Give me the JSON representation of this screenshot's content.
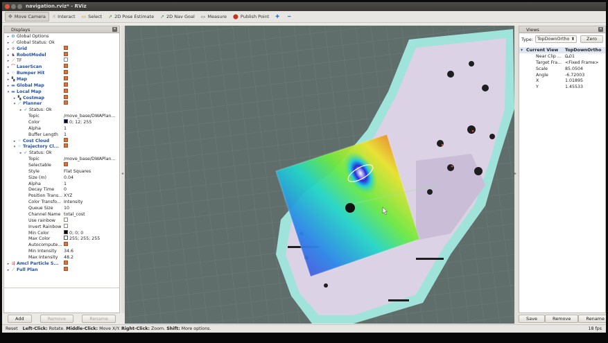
{
  "window": {
    "title": "navigation.rviz* - RViz"
  },
  "toolbar": [
    {
      "label": "Move Camera",
      "icon": "move-camera-icon",
      "glyph": "✥",
      "color": "#666",
      "active": true
    },
    {
      "label": "Interact",
      "icon": "interact-hand-icon",
      "glyph": "☝",
      "color": "#444"
    },
    {
      "label": "Select",
      "icon": "select-box-icon",
      "glyph": "▭",
      "color": "#b89a00"
    },
    {
      "label": "2D Pose Estimate",
      "icon": "pose-estimate-arrow-icon",
      "glyph": "➚",
      "color": "#2f9b2f"
    },
    {
      "label": "2D Nav Goal",
      "icon": "nav-goal-arrow-icon",
      "glyph": "➚",
      "color": "#2f9b2f"
    },
    {
      "label": "Measure",
      "icon": "measure-icon",
      "glyph": "▭",
      "color": "#555"
    },
    {
      "label": "Publish Point",
      "icon": "publish-point-pin-icon",
      "glyph": "⬤",
      "color": "#c4341f"
    },
    {
      "label": "",
      "icon": "add-tool-plus-icon",
      "glyph": "✚",
      "color": "#2a6fd6"
    },
    {
      "label": "",
      "icon": "remove-tool-minus-icon",
      "glyph": "━",
      "color": "#2a6fd6"
    }
  ],
  "displays": {
    "title": "Displays",
    "rows": [
      {
        "indent": 0,
        "arrow": "▸",
        "icon": "gear-icon",
        "glyph": "⚙",
        "glyph_color": "#2a6fd6",
        "label": "Global Options",
        "style": "plain",
        "value": ""
      },
      {
        "indent": 0,
        "arrow": "▸",
        "icon": "checkmark-icon",
        "glyph": "✓",
        "glyph_color": "#2a8a2a",
        "label": "Global Status: Ok",
        "style": "plain",
        "value": ""
      },
      {
        "indent": 0,
        "arrow": "▸",
        "icon": "grid-icon",
        "glyph": "✣",
        "glyph_color": "#777",
        "label": "Grid",
        "style": "blue",
        "checkbox": true
      },
      {
        "indent": 0,
        "arrow": "▸",
        "icon": "robot-model-icon",
        "glyph": "♞",
        "glyph_color": "#555",
        "label": "RobotModel",
        "style": "blue",
        "checkbox": true
      },
      {
        "indent": 0,
        "arrow": "▸",
        "icon": "tf-axes-icon",
        "glyph": "⟋",
        "glyph_color": "#d44",
        "label": "TF",
        "style": "plain",
        "checkbox": false
      },
      {
        "indent": 0,
        "arrow": "▸",
        "icon": "laser-scan-icon",
        "glyph": "⌒",
        "glyph_color": "#d22",
        "label": "LaserScan",
        "style": "blue",
        "checkbox": true
      },
      {
        "indent": 0,
        "arrow": "▸",
        "icon": "bumper-points-icon",
        "glyph": "⁘",
        "glyph_color": "#2a6fd6",
        "label": "Bumper Hit",
        "style": "blue",
        "checkbox": true
      },
      {
        "indent": 0,
        "arrow": "▸",
        "icon": "map-icon",
        "glyph": "▚",
        "glyph_color": "#555",
        "label": "Map",
        "style": "blue",
        "checkbox": true
      },
      {
        "indent": 0,
        "arrow": "▸",
        "icon": "folder-icon",
        "glyph": "▬",
        "glyph_color": "#5a7fb5",
        "label": "Global Map",
        "style": "blue",
        "checkbox": true
      },
      {
        "indent": 0,
        "arrow": "▾",
        "icon": "folder-icon",
        "glyph": "▬",
        "glyph_color": "#5a7fb5",
        "label": "Local Map",
        "style": "blue",
        "checkbox": true
      },
      {
        "indent": 1,
        "arrow": "▸",
        "icon": "map-icon",
        "glyph": "▚",
        "glyph_color": "#555",
        "label": "Costmap",
        "style": "blue",
        "checkbox": true
      },
      {
        "indent": 1,
        "arrow": "▾",
        "icon": "path-icon",
        "glyph": "⟋",
        "glyph_color": "#2a9a2a",
        "label": "Planner",
        "style": "blue",
        "checkbox": true
      },
      {
        "indent": 2,
        "arrow": "▸",
        "icon": "checkmark-icon",
        "glyph": "✓",
        "glyph_color": "#2a8a2a",
        "label": "Status: Ok",
        "style": "plain",
        "value": ""
      },
      {
        "indent": 2,
        "label": "Topic",
        "style": "plain",
        "value": "/move_base/DWAPlan..."
      },
      {
        "indent": 2,
        "label": "Color",
        "style": "plain",
        "swatch": "#00004a",
        "value": "0; 12; 255"
      },
      {
        "indent": 2,
        "label": "Alpha",
        "style": "plain",
        "value": "1"
      },
      {
        "indent": 2,
        "label": "Buffer Length",
        "style": "plain",
        "value": "1"
      },
      {
        "indent": 1,
        "arrow": "▸",
        "icon": "point-cloud-icon",
        "glyph": "⁘",
        "glyph_color": "#2a6fd6",
        "label": "Cost Cloud",
        "style": "blue",
        "checkbox": true
      },
      {
        "indent": 1,
        "arrow": "▾",
        "icon": "point-cloud-icon",
        "glyph": "⁘",
        "glyph_color": "#2a6fd6",
        "label": "Trajectory Cl...",
        "style": "blue",
        "checkbox": true
      },
      {
        "indent": 2,
        "arrow": "▸",
        "icon": "checkmark-icon",
        "glyph": "✓",
        "glyph_color": "#2a8a2a",
        "label": "Status: Ok",
        "style": "plain",
        "value": ""
      },
      {
        "indent": 2,
        "label": "Topic",
        "style": "plain",
        "value": "/move_base/DWAPlan..."
      },
      {
        "indent": 2,
        "label": "Selectable",
        "style": "plain",
        "checkbox": true
      },
      {
        "indent": 2,
        "label": "Style",
        "style": "plain",
        "value": "Flat Squares"
      },
      {
        "indent": 2,
        "label": "Size (m)",
        "style": "plain",
        "value": "0.04"
      },
      {
        "indent": 2,
        "label": "Alpha",
        "style": "plain",
        "value": "1"
      },
      {
        "indent": 2,
        "label": "Decay Time",
        "style": "plain",
        "value": "0"
      },
      {
        "indent": 2,
        "label": "Position Trans...",
        "style": "plain",
        "value": "XYZ"
      },
      {
        "indent": 2,
        "label": "Color Transfo...",
        "style": "plain",
        "value": "Intensity"
      },
      {
        "indent": 2,
        "label": "Queue Size",
        "style": "plain",
        "value": "10"
      },
      {
        "indent": 2,
        "label": "Channel Name",
        "style": "plain",
        "value": "total_cost"
      },
      {
        "indent": 2,
        "label": "Use rainbow",
        "style": "plain",
        "checkbox": false
      },
      {
        "indent": 2,
        "label": "Invert Rainbow",
        "style": "plain",
        "checkbox": false
      },
      {
        "indent": 2,
        "label": "Min Color",
        "style": "plain",
        "swatch": "#000000",
        "value": "0; 0; 0"
      },
      {
        "indent": 2,
        "label": "Max Color",
        "style": "plain",
        "swatch": "#ffffff",
        "value": "255; 255; 255"
      },
      {
        "indent": 2,
        "label": "Autocompute...",
        "style": "plain",
        "checkbox": true
      },
      {
        "indent": 2,
        "label": "Min Intensity",
        "style": "plain",
        "value": "34.6"
      },
      {
        "indent": 2,
        "label": "Max Intensity",
        "style": "plain",
        "value": "48.2"
      },
      {
        "indent": 0,
        "arrow": "▸",
        "icon": "particle-arrows-icon",
        "glyph": "⇶",
        "glyph_color": "#d44",
        "label": "Amcl Particle S...",
        "style": "blue",
        "checkbox": true
      },
      {
        "indent": 0,
        "arrow": "▸",
        "icon": "path-icon",
        "glyph": "⟋",
        "glyph_color": "#2a9a2a",
        "label": "Full Plan",
        "style": "blue",
        "checkbox": true
      }
    ],
    "buttons": [
      {
        "label": "Add",
        "enabled": true
      },
      {
        "label": "Remove",
        "enabled": false
      },
      {
        "label": "Rename",
        "enabled": false
      }
    ]
  },
  "views": {
    "title": "Views",
    "type_label": "Type:",
    "type_value": "TopDownOrtho",
    "zero_label": "Zero",
    "header": {
      "label": "Current View",
      "value": "TopDownOrtho ..."
    },
    "props": [
      {
        "label": "Near Clip ...",
        "value": "0.01"
      },
      {
        "label": "Target Fra...",
        "value": "<Fixed Frame>"
      },
      {
        "label": "Scale",
        "value": "85.0504"
      },
      {
        "label": "Angle",
        "value": "-6.72003"
      },
      {
        "label": "X",
        "value": "1.01895"
      },
      {
        "label": "Y",
        "value": "1.45533"
      }
    ],
    "buttons": [
      {
        "label": "Save"
      },
      {
        "label": "Remove"
      },
      {
        "label": "Rename"
      }
    ]
  },
  "status": {
    "reset": "Reset",
    "parts": [
      {
        "text": "Left-Click:",
        "bold": true
      },
      {
        "text": " Rotate. ",
        "bold": false
      },
      {
        "text": "Middle-Click:",
        "bold": true
      },
      {
        "text": " Move X/Y. ",
        "bold": false
      },
      {
        "text": "Right-Click:",
        "bold": true
      },
      {
        "text": " Zoom. ",
        "bold": false
      },
      {
        "text": "Shift:",
        "bold": true
      },
      {
        "text": " More options.",
        "bold": false
      }
    ],
    "fps": "18 fps"
  },
  "colors": {
    "map_background": "#5f6e6b",
    "free_space": "#dcd2e6",
    "inflation": "#9fe3da",
    "obstacle": "#1e1e1e",
    "checkbox_checked": "#d9743a",
    "tree_label_blue": "#1f4fa8"
  }
}
